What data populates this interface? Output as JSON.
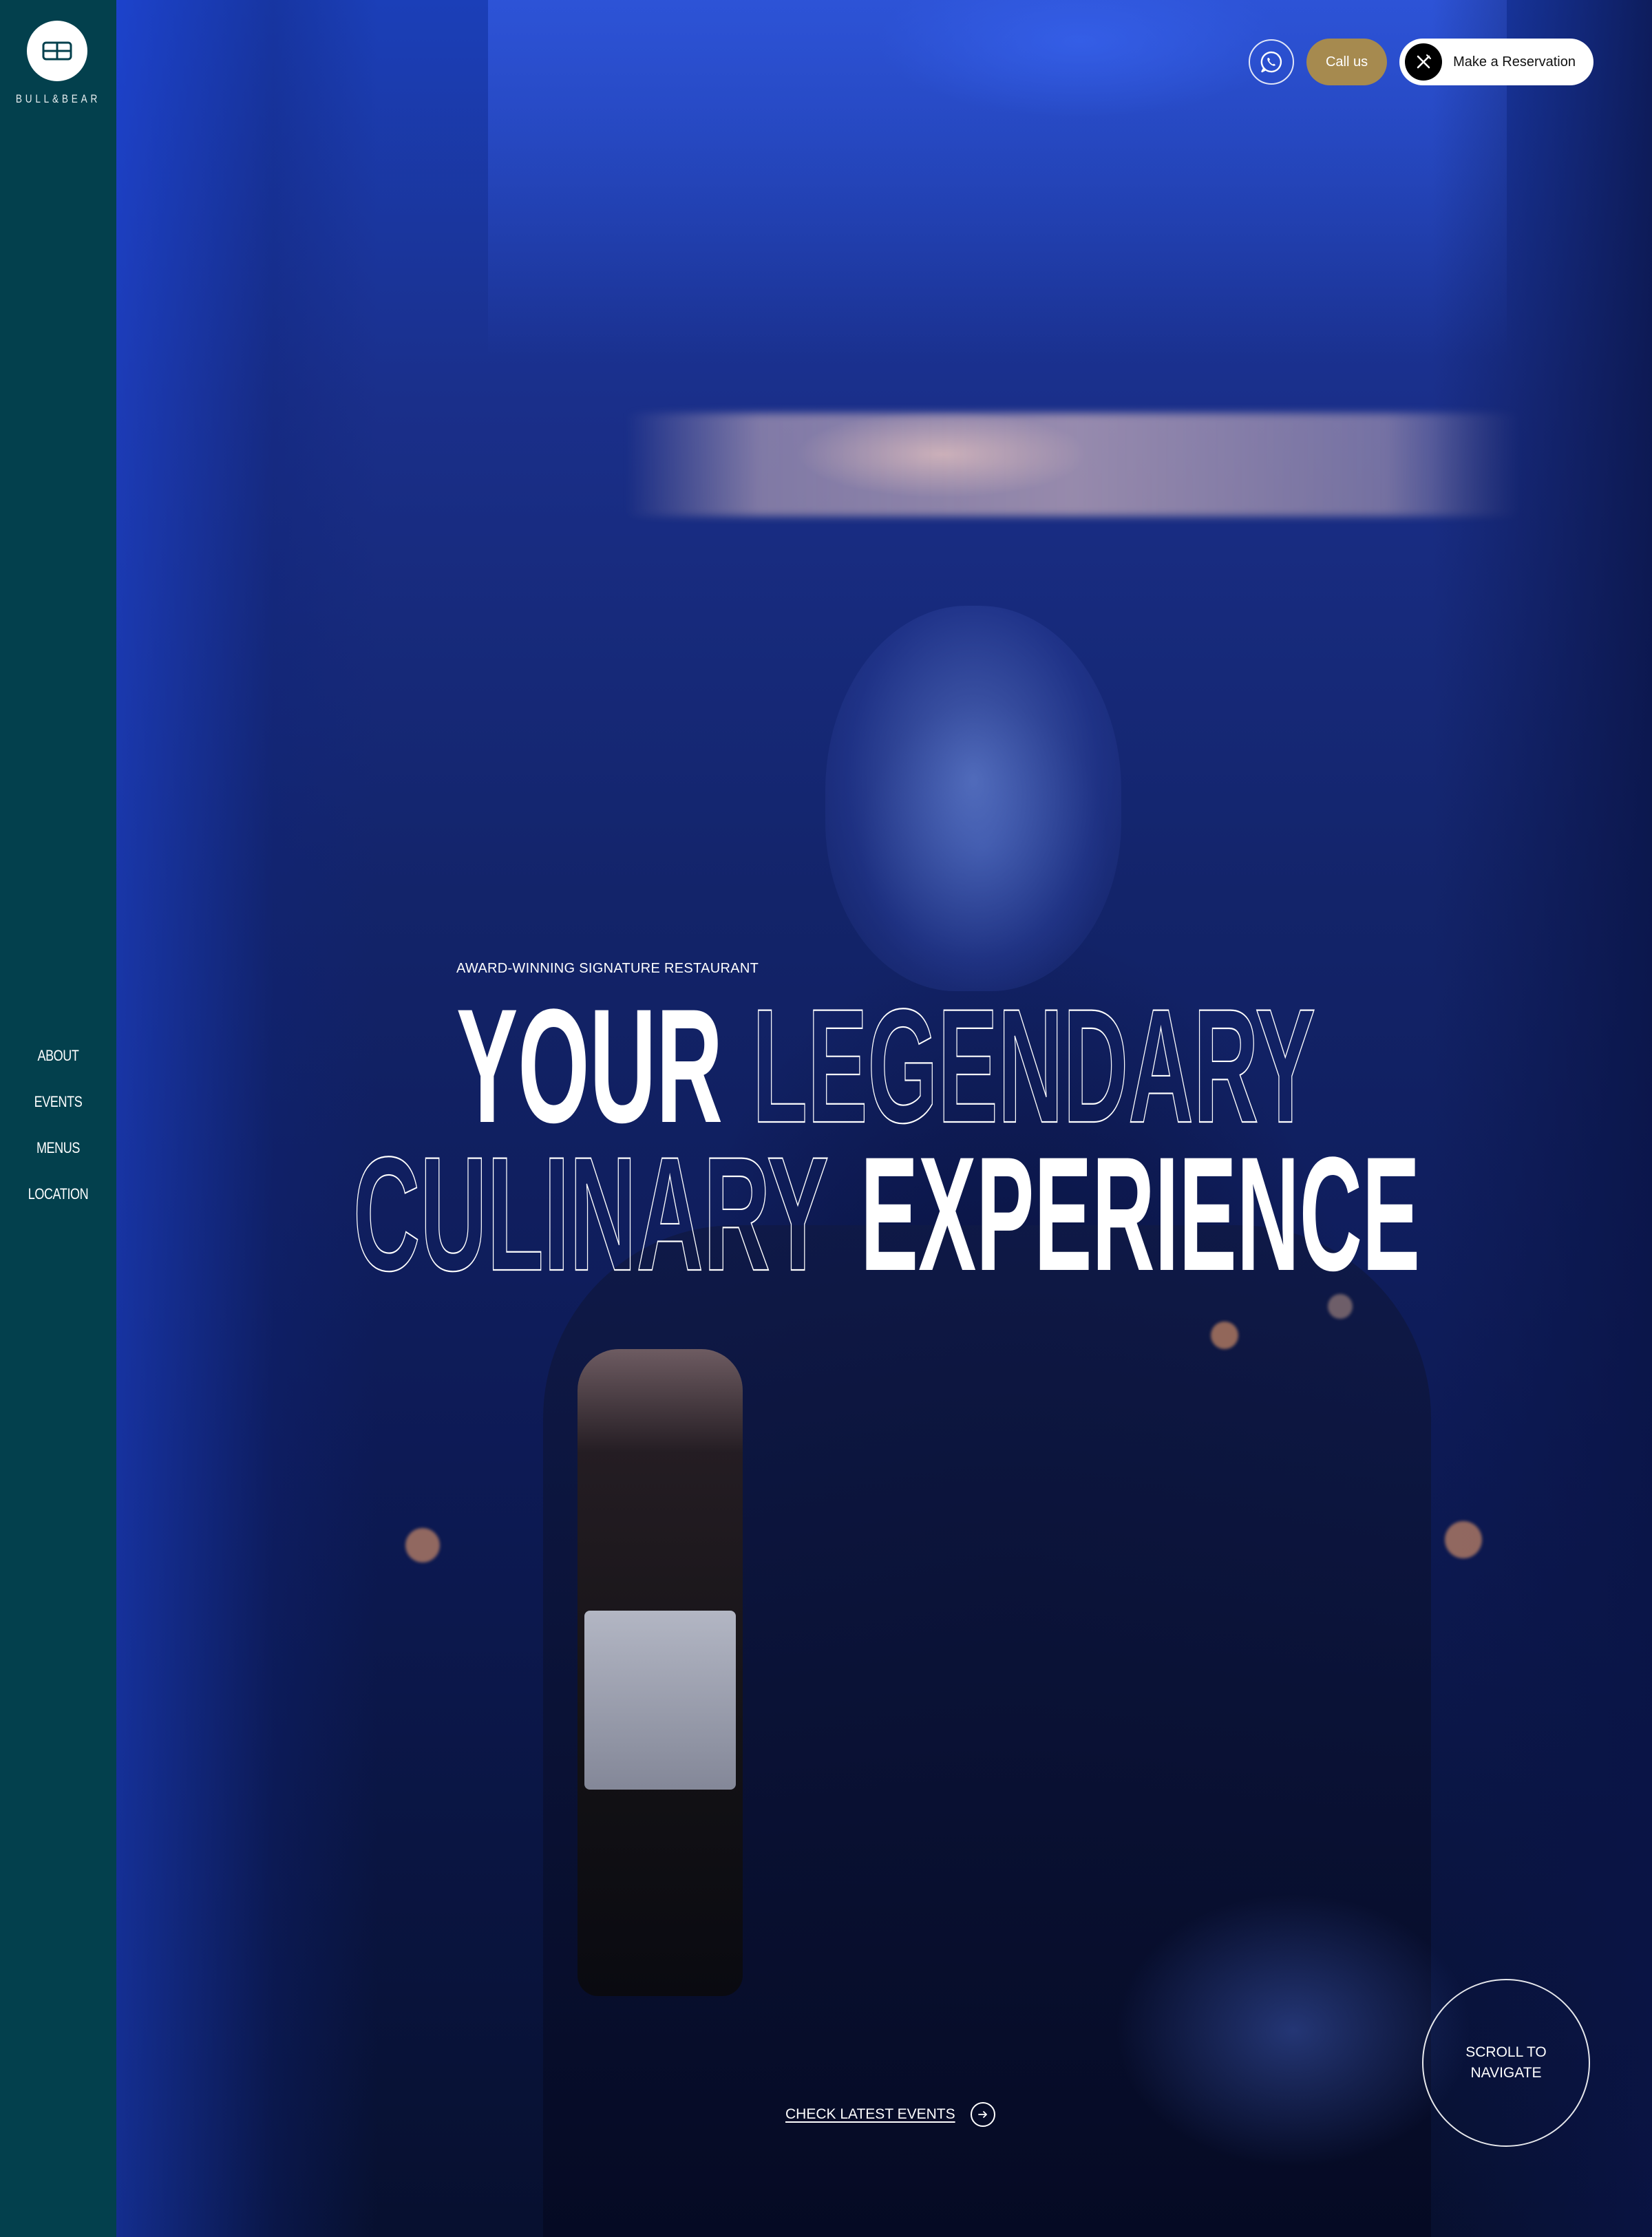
{
  "brand": {
    "name": "BULL&BEAR",
    "sidebar_color": "#03404d"
  },
  "sidebar": {
    "items": [
      {
        "label": "ABOUT"
      },
      {
        "label": "EVENTS"
      },
      {
        "label": "MENUS"
      },
      {
        "label": "LOCATION"
      }
    ]
  },
  "header": {
    "whatsapp_icon": "whatsapp-icon",
    "call_label": "Call us",
    "call_color": "#a68a4f",
    "reservation_label": "Make a Reservation",
    "reservation_icon": "fork-knife-icon"
  },
  "hero": {
    "eyebrow": "AWARD-WINNING SIGNATURE RESTAURANT",
    "title_line1_solid": "YOUR",
    "title_line1_outline": "LEGENDARY",
    "title_line2_outline": "CULINARY",
    "title_line2_solid": "EXPERIENCE"
  },
  "cta": {
    "events_label": "CHECK LATEST EVENTS",
    "events_icon": "arrow-right-icon",
    "scroll_label": "SCROLL TO NAVIGATE"
  }
}
